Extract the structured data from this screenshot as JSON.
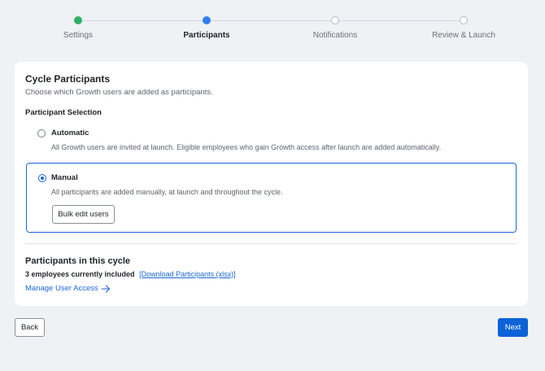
{
  "stepper": {
    "steps": [
      {
        "label": "Settings",
        "state": "done"
      },
      {
        "label": "Participants",
        "state": "active"
      },
      {
        "label": "Notifications",
        "state": "upcoming"
      },
      {
        "label": "Review & Launch",
        "state": "upcoming"
      }
    ]
  },
  "card": {
    "title": "Cycle Participants",
    "subtitle": "Choose which Growth users are added as participants.",
    "section_label": "Participant Selection",
    "options": {
      "automatic": {
        "label": "Automatic",
        "description": "All Growth users are invited at launch. Eligible employees who gain Growth access after launch are added automatically.",
        "selected": false
      },
      "manual": {
        "label": "Manual",
        "description": "All participants are added manually, at launch and throughout the cycle.",
        "selected": true,
        "button_label": "Bulk edit users"
      }
    },
    "participants": {
      "title": "Participants in this cycle",
      "count_text": "3 employees currently included",
      "download_link": "[Download Participants (xlsx)]",
      "manage_link": "Manage User Access"
    }
  },
  "footer": {
    "back_label": "Back",
    "next_label": "Next"
  },
  "colors": {
    "accent": "#1b67d6",
    "primary_button": "#0b63d8",
    "step_done": "#2fb066",
    "step_active": "#2f80ed",
    "background": "#f0f1f5"
  },
  "icons": {
    "manage_link_icon": "arrow-right-icon"
  }
}
